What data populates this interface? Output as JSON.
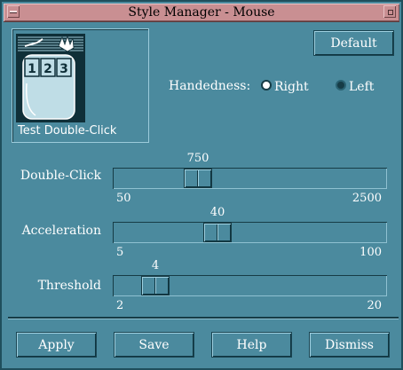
{
  "window": {
    "title": "Style Manager - Mouse"
  },
  "test_area": {
    "label": "Test Double-Click",
    "icon_digits": [
      "1",
      "2",
      "3"
    ]
  },
  "default_button": "Default",
  "handedness": {
    "label": "Handedness:",
    "options": [
      {
        "label": "Right",
        "selected": true
      },
      {
        "label": "Left",
        "selected": false
      }
    ]
  },
  "sliders": {
    "double_click": {
      "label": "Double-Click",
      "value": "750",
      "min": "50",
      "max": "2500",
      "fraction": 0.286
    },
    "acceleration": {
      "label": "Acceleration",
      "value": "40",
      "min": "5",
      "max": "100",
      "fraction": 0.368
    },
    "threshold": {
      "label": "Threshold",
      "value": "4",
      "min": "2",
      "max": "20",
      "fraction": 0.111
    }
  },
  "buttons": {
    "apply": "Apply",
    "save": "Save",
    "help": "Help",
    "dismiss": "Dismiss"
  },
  "colors": {
    "background": "#4b8a9e",
    "titlebar": "#c98f92",
    "dark_bevel": "#163c46",
    "light_bevel": "#8fc1d1"
  }
}
